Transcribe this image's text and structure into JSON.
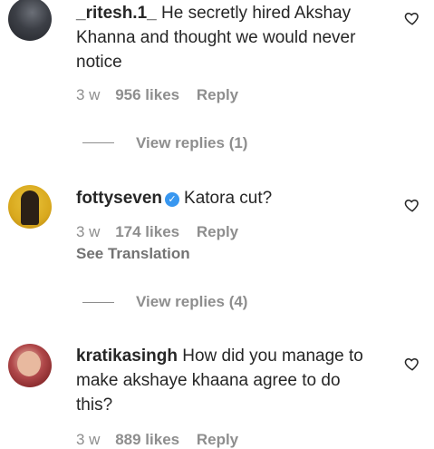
{
  "comments": [
    {
      "username": "_ritesh.1_",
      "text": "He secretly hired Akshay Khanna and thought we would never notice",
      "age": "3 w",
      "likes": "956 likes",
      "reply_label": "Reply",
      "view_replies": "View replies (1)"
    },
    {
      "username": "fottyseven",
      "verified": true,
      "text": "Katora cut?",
      "age": "3 w",
      "likes": "174 likes",
      "reply_label": "Reply",
      "see_translation": "See Translation",
      "view_replies": "View replies (4)"
    },
    {
      "username": "kratikasingh",
      "text": "How did you manage to make akshaye khaana agree to do this?",
      "age": "3 w",
      "likes": "889 likes",
      "reply_label": "Reply"
    }
  ],
  "icons": {
    "like": "heart-outline-icon",
    "verified": "verified-badge-icon"
  },
  "colors": {
    "text": "#262626",
    "muted": "#8e8e8e",
    "verified": "#3897f0"
  }
}
